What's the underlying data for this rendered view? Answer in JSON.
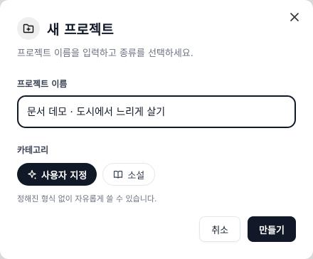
{
  "dialog": {
    "title": "새 프로젝트",
    "subtitle": "프로젝트 이름을 입력하고 종류를 선택하세요.",
    "title_icon": "folder-plus-icon",
    "close_icon": "close-icon"
  },
  "name_field": {
    "label": "프로젝트 이름",
    "value": "문서 데모 · 도시에서 느리게 살기"
  },
  "category": {
    "label": "카테고리",
    "options": [
      {
        "label": "사용자 지정",
        "icon": "sparkles-icon",
        "selected": true
      },
      {
        "label": "소설",
        "icon": "book-icon",
        "selected": false
      }
    ],
    "hint": "정해진 형식 없이 자유롭게 쓸 수 있습니다."
  },
  "actions": {
    "cancel_label": "취소",
    "create_label": "만들기"
  },
  "colors": {
    "primary": "#111827",
    "muted_text": "#6b7280",
    "border": "#e5e7eb"
  }
}
